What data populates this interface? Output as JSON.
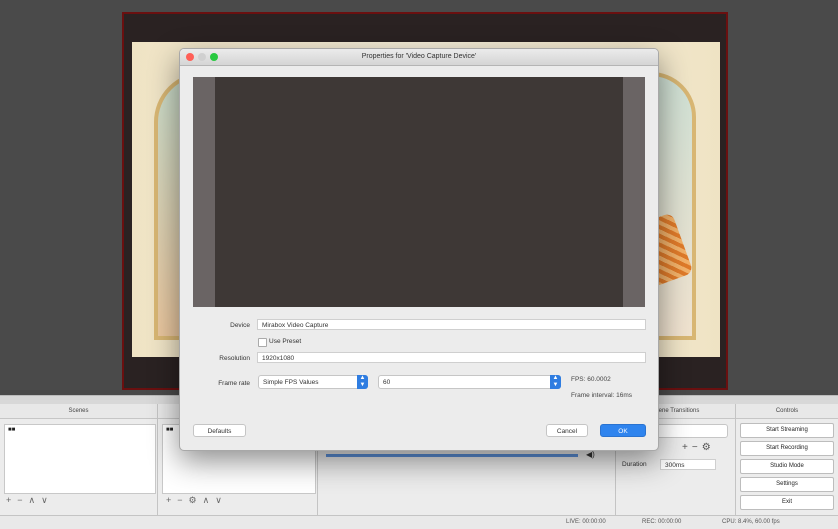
{
  "dialog": {
    "title": "Properties for 'Video Capture Device'",
    "device_label": "Device",
    "device_value": "Mirabox Video Capture",
    "use_preset_label": "Use Preset",
    "resolution_label": "Resolution",
    "resolution_value": "1920x1080",
    "frame_rate_label": "Frame rate",
    "frame_rate_mode": "Simple FPS Values",
    "frame_rate_value": "60",
    "fps_readout": "FPS: 60.0002",
    "frame_interval": "Frame interval: 16ms",
    "defaults_label": "Defaults",
    "cancel_label": "Cancel",
    "ok_label": "OK"
  },
  "panels": {
    "scenes_header": "Scenes",
    "scene_row_text": "■■",
    "sources_row_text": "■■",
    "transitions_header": "Scene Transitions",
    "duration_label": "Duration",
    "duration_value": "300ms",
    "controls_header": "Controls",
    "buttons": [
      "Start Streaming",
      "Start Recording",
      "Studio Mode",
      "Settings",
      "Exit"
    ]
  },
  "status": {
    "live": "LIVE: 00:00:00",
    "rec": "REC: 00:00:00",
    "cpu": "CPU: 8.4%, 60.00 fps"
  },
  "colors": {
    "accent": "#2f84ee",
    "canvas_border": "#6a1010",
    "traffic_red": "#ff5f57",
    "traffic_yellow": "#d0d0d0",
    "traffic_green": "#28c940"
  }
}
